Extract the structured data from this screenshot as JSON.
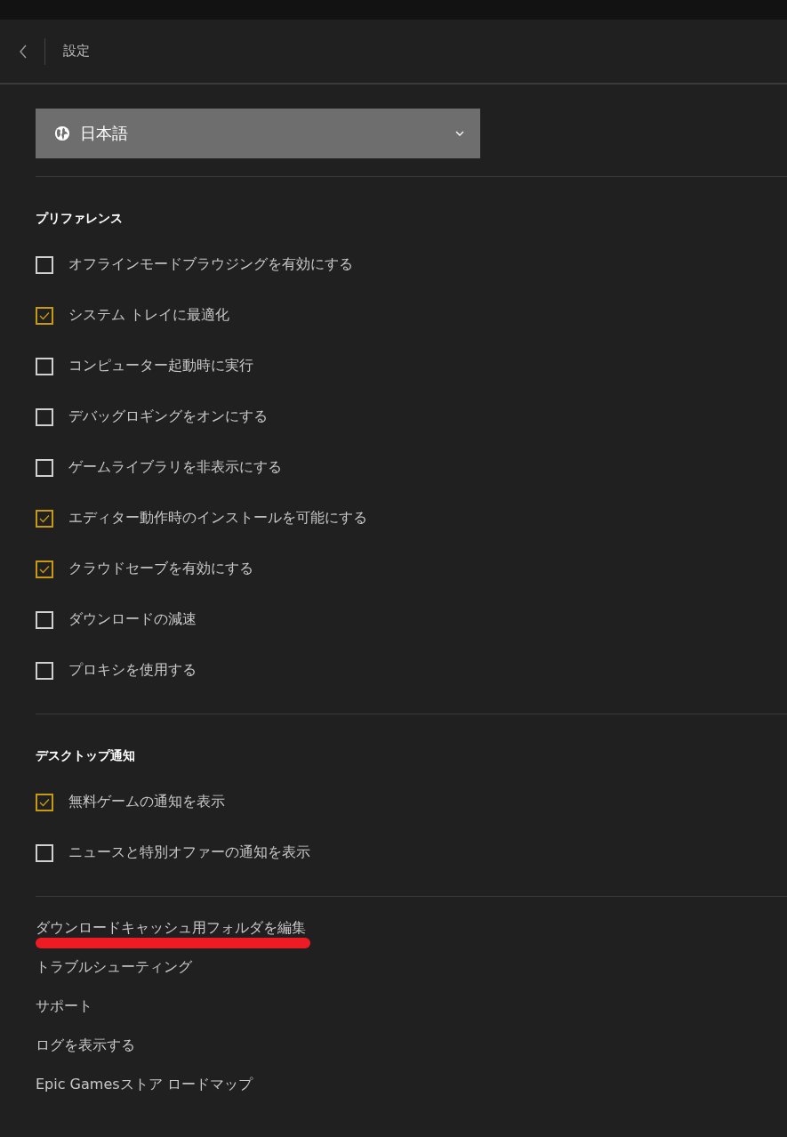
{
  "header": {
    "title": "設定"
  },
  "language_dropdown": {
    "value": "日本語"
  },
  "sections": [
    {
      "title": "プリファレンス",
      "options": [
        {
          "label": "オフラインモードブラウジングを有効にする",
          "checked": false
        },
        {
          "label": "システム トレイに最適化",
          "checked": true
        },
        {
          "label": "コンピューター起動時に実行",
          "checked": false
        },
        {
          "label": "デバッグロギングをオンにする",
          "checked": false
        },
        {
          "label": "ゲームライブラリを非表示にする",
          "checked": false
        },
        {
          "label": "エディター動作時のインストールを可能にする",
          "checked": true
        },
        {
          "label": "クラウドセーブを有効にする",
          "checked": true
        },
        {
          "label": "ダウンロードの減速",
          "checked": false
        },
        {
          "label": "プロキシを使用する",
          "checked": false
        }
      ]
    },
    {
      "title": "デスクトップ通知",
      "options": [
        {
          "label": "無料ゲームの通知を表示",
          "checked": true
        },
        {
          "label": "ニュースと特別オファーの通知を表示",
          "checked": false
        }
      ]
    }
  ],
  "links": [
    {
      "label": "ダウンロードキャッシュ用フォルダを編集",
      "underlined": true
    },
    {
      "label": "トラブルシューティング",
      "underlined": false
    },
    {
      "label": "サポート",
      "underlined": false
    },
    {
      "label": "ログを表示する",
      "underlined": false
    },
    {
      "label": "Epic Gamesストア ロードマップ",
      "underlined": false
    }
  ]
}
